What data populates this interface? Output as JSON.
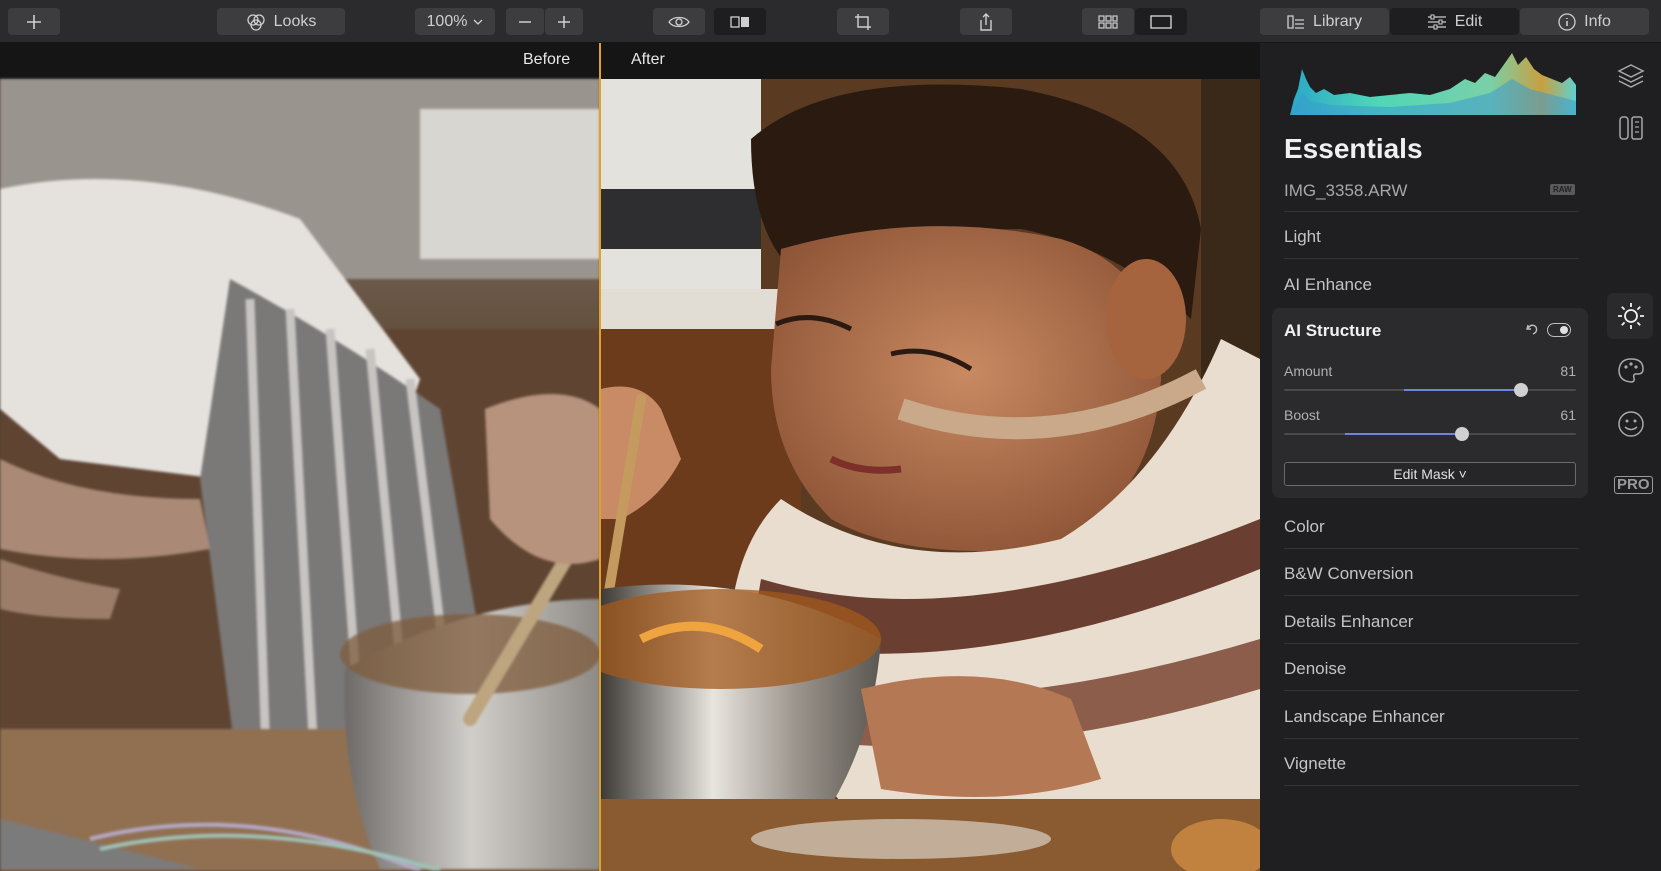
{
  "toolbar": {
    "looks_label": "Looks",
    "zoom_value": "100%",
    "library_label": "Library",
    "edit_label": "Edit",
    "info_label": "Info"
  },
  "canvas": {
    "before_label": "Before",
    "after_label": "After"
  },
  "panel": {
    "title": "Essentials",
    "filename": "IMG_3358.ARW",
    "raw_badge": "RAW",
    "sections_top": [
      "Light",
      "AI Enhance"
    ],
    "active_tool": {
      "title": "AI Structure",
      "sliders": [
        {
          "label": "Amount",
          "value": "81",
          "level": 0.81
        },
        {
          "label": "Boost",
          "value": "61",
          "level": 0.61
        }
      ],
      "mask_button": "Edit Mask ˅"
    },
    "sections_bottom": [
      "Color",
      "B&W Conversion",
      "Details Enhancer",
      "Denoise",
      "Landscape Enhancer",
      "Vignette"
    ]
  },
  "rail": {
    "pro_label": "PRO"
  },
  "colors": {
    "divider": "#e0a12a",
    "slider_fill": "#6d87d8",
    "toolbar_bg": "#2b2b2d",
    "panel_bg": "#1f1f21"
  }
}
